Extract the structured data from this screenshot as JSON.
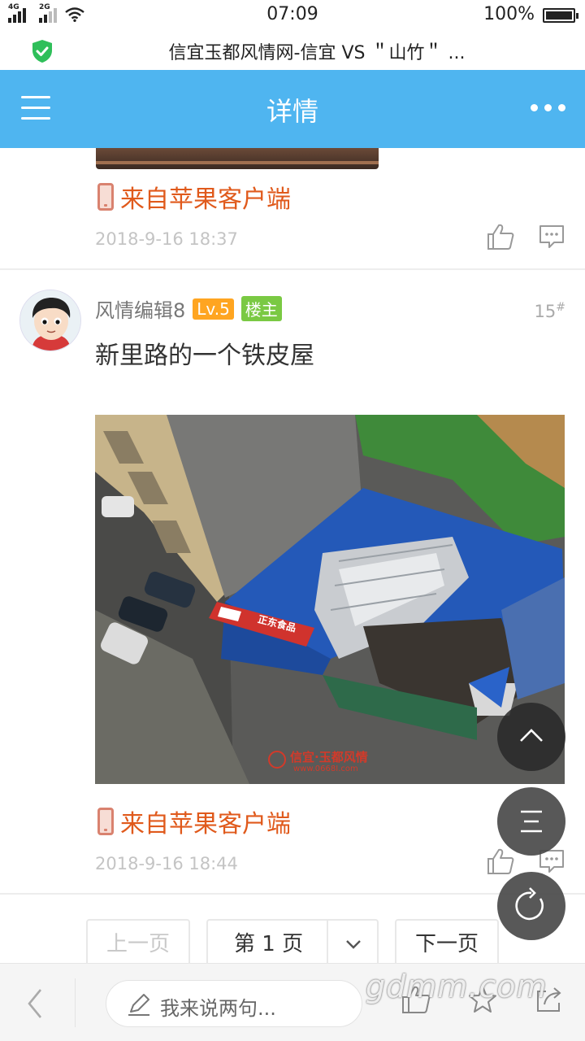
{
  "status_bar": {
    "network_1": "4G",
    "network_2": "2G",
    "time": "07:09",
    "battery_percent": "100%"
  },
  "browser": {
    "page_title": "信宜玉都风情网-信宜 VS ＂山竹＂ ..."
  },
  "header": {
    "title": "详情"
  },
  "posts": [
    {
      "source": "来自苹果客户端",
      "date": "2018-9-16 18:37"
    },
    {
      "author": "风情编辑8",
      "level": "Lv.5",
      "role": "楼主",
      "floor": "15",
      "floor_mark": "#",
      "text": "新里路的一个铁皮屋",
      "image_watermark": "信宜·玉都风情",
      "image_watermark_url": "www.0668I.com",
      "image_sign": "正东食品",
      "source": "来自苹果客户端",
      "date": "2018-9-16 18:44"
    }
  ],
  "pagination": {
    "prev_label": "上一页",
    "current_label": "第 1 页",
    "next_label": "下一页"
  },
  "bottom_bar": {
    "comment_placeholder": "我来说两句...",
    "watermark": "gdmm.com"
  },
  "colors": {
    "header_bg": "#4fb5f0",
    "source_text": "#e05a1c",
    "level_badge": "#ffa521",
    "host_badge": "#7ac943"
  },
  "icons": [
    "shield-check-icon",
    "menu-icon",
    "more-icon",
    "phone-icon",
    "like-icon",
    "comment-icon",
    "chevron-down-icon",
    "scroll-top-icon",
    "list-icon",
    "refresh-icon",
    "back-icon",
    "pen-icon",
    "star-icon",
    "share-icon"
  ]
}
